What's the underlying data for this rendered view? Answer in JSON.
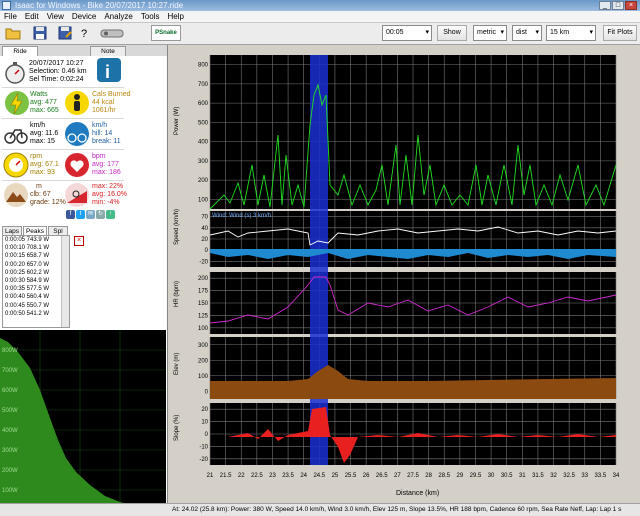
{
  "window": {
    "title": "Isaac for Windows - Bike 20/07/2017 10:27.ride"
  },
  "menu": [
    "File",
    "Edit",
    "View",
    "Device",
    "Analyze",
    "Tools",
    "Help"
  ],
  "toolbar": {
    "logo": "PSnake",
    "time_value": "00:05",
    "show_label": "Show",
    "units_value": "metric",
    "dist_value": "dist",
    "zoom_value": "15 km",
    "fit_label": "Fit Plots"
  },
  "left_tabs": [
    "Ride",
    "Note"
  ],
  "summary": {
    "date": "20/07/2017 10:27",
    "selection": "Selection: 0.46 km",
    "sel_time": "Sel Time: 0:02:24",
    "watts_label": "Watts",
    "watts_avg": "avg: 477",
    "watts_max": "max: 665",
    "cal_label": "Cals Burned",
    "cal_kcal": "44 kcal",
    "cal_rate": "1061/hr",
    "speed_label": "km/h",
    "speed_avg": "avg: 11.6",
    "speed_max": "max: 15",
    "climb_label": "km/h",
    "climb_hill": "hill: 14",
    "climb_break": "break: 11",
    "rpm_label": "rpm",
    "rpm_avg": "avg: 67.1",
    "rpm_max": "max: 93",
    "bpm_label": "bpm",
    "bpm_avg": "avg: 177",
    "bpm_max": "max: 186",
    "elev_label": "m",
    "elev_climb": "clb: 67",
    "elev_grade": "grade: 12%",
    "grade_max": "max: 22%",
    "grade_avg": "avg: 16.0%",
    "grade_min": "min: -4%"
  },
  "sub_tabs": [
    "Laps",
    "Peaks",
    "Spl"
  ],
  "peaks": [
    "0:00:05 743.9 W",
    "0:00:10 708.1 W",
    "0:00:15 658.7 W",
    "0:00:20 657.0 W",
    "0:00:25 602.2 W",
    "0:00:30 584.9 W",
    "0:00:35 577.5 W",
    "0:00:40 560.4 W",
    "0:00:45 550.7 W",
    "0:00:50 541.2 W"
  ],
  "power_curve_ticks": [
    "800W",
    "700W",
    "600W",
    "500W",
    "400W",
    "300W",
    "200W",
    "100W"
  ],
  "charts": {
    "power": {
      "ylabel": "Power (W)",
      "yticks": [
        "800",
        "700",
        "600",
        "500",
        "400",
        "300",
        "200",
        "100"
      ]
    },
    "speed": {
      "ylabel": "Speed (km/h)",
      "legend": "Wind: Wind (s) 3 km/h",
      "yticks": [
        "70",
        "40",
        "20",
        "0",
        "-20"
      ]
    },
    "hr": {
      "ylabel": "HR (bpm)",
      "yticks": [
        "200",
        "175",
        "150",
        "125",
        "100"
      ]
    },
    "elev": {
      "ylabel": "Elev (m)",
      "yticks": [
        "300",
        "200",
        "100",
        "0"
      ]
    },
    "slope": {
      "ylabel": "Slope (%)",
      "yticks": [
        "20",
        "10",
        "0",
        "-10",
        "-20"
      ]
    },
    "xticks": [
      "21",
      "21.5",
      "22",
      "22.5",
      "23",
      "23.5",
      "24",
      "24.5",
      "25",
      "25.5",
      "26",
      "26.5",
      "27",
      "27.5",
      "28",
      "28.5",
      "29",
      "29.5",
      "30",
      "30.5",
      "31",
      "31.5",
      "32",
      "32.5",
      "33",
      "33.5",
      "34"
    ],
    "xlabel": "Distance (km)"
  },
  "status": "At: 24.02 (25.8 km): Power: 380 W, Speed 14.0 km/h, Wind 3.0 km/h, Elev 125 m, Slope 13.5%, HR 188 bpm, Cadence 60 rpm, Sea Rate Neff, Lap: Lap 1 s"
}
